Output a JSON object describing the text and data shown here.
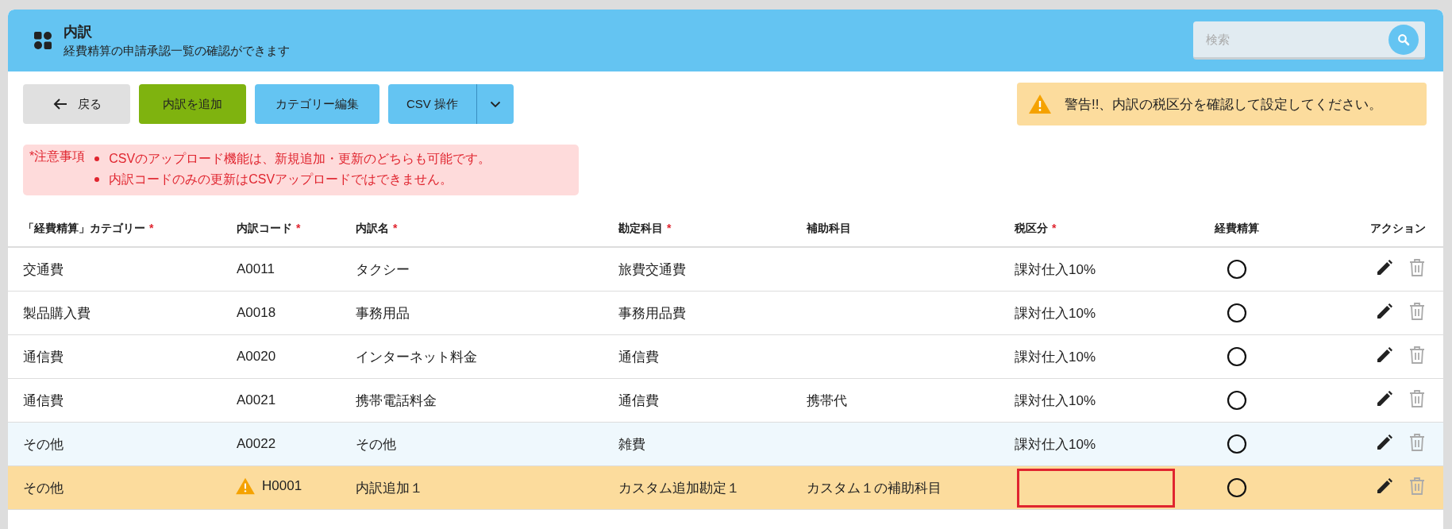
{
  "header": {
    "title": "内訳",
    "subtitle": "経費精算の申請承認一覧の確認ができます"
  },
  "search": {
    "placeholder": "検索"
  },
  "toolbar": {
    "back": "戻る",
    "add": "内訳を追加",
    "category_edit": "カテゴリー編集",
    "csv": "CSV 操作"
  },
  "warning": "警告!!、内訳の税区分を確認して設定してください。",
  "notice": {
    "label": "*注意事項",
    "items": [
      "CSVのアップロード機能は、新規追加・更新のどちらも可能です。",
      "内訳コードのみの更新はCSVアップロードではできません。"
    ]
  },
  "table": {
    "required_mark": "*",
    "columns": [
      {
        "label": "「経費精算」カテゴリー",
        "required": true
      },
      {
        "label": "内訳コード",
        "required": true
      },
      {
        "label": "内訳名",
        "required": true
      },
      {
        "label": "勘定科目",
        "required": true
      },
      {
        "label": "補助科目",
        "required": false
      },
      {
        "label": "税区分",
        "required": true
      },
      {
        "label": "経費精算",
        "required": false
      },
      {
        "label": "アクション",
        "required": false
      }
    ],
    "rows": [
      {
        "category": "交通費",
        "code": "A0011",
        "name": "タクシー",
        "account": "旅費交通費",
        "sub_account": "",
        "tax": "課対仕入10%",
        "expense": true,
        "hovered": false,
        "warning": false,
        "delete_disabled": true
      },
      {
        "category": "製品購入費",
        "code": "A0018",
        "name": "事務用品",
        "account": "事務用品費",
        "sub_account": "",
        "tax": "課対仕入10%",
        "expense": true,
        "hovered": false,
        "warning": false,
        "delete_disabled": true
      },
      {
        "category": "通信費",
        "code": "A0020",
        "name": "インターネット料金",
        "account": "通信費",
        "sub_account": "",
        "tax": "課対仕入10%",
        "expense": true,
        "hovered": false,
        "warning": false,
        "delete_disabled": true
      },
      {
        "category": "通信費",
        "code": "A0021",
        "name": "携帯電話料金",
        "account": "通信費",
        "sub_account": "携帯代",
        "tax": "課対仕入10%",
        "expense": true,
        "hovered": false,
        "warning": false,
        "delete_disabled": true
      },
      {
        "category": "その他",
        "code": "A0022",
        "name": "その他",
        "account": "雑費",
        "sub_account": "",
        "tax": "課対仕入10%",
        "expense": true,
        "hovered": true,
        "warning": false,
        "delete_disabled": true
      },
      {
        "category": "その他",
        "code": "H0001",
        "name": "内訳追加１",
        "account": "カスタム追加勘定１",
        "sub_account": "カスタム１の補助科目",
        "tax": "",
        "expense": true,
        "hovered": false,
        "warning": true,
        "delete_disabled": true
      }
    ]
  }
}
